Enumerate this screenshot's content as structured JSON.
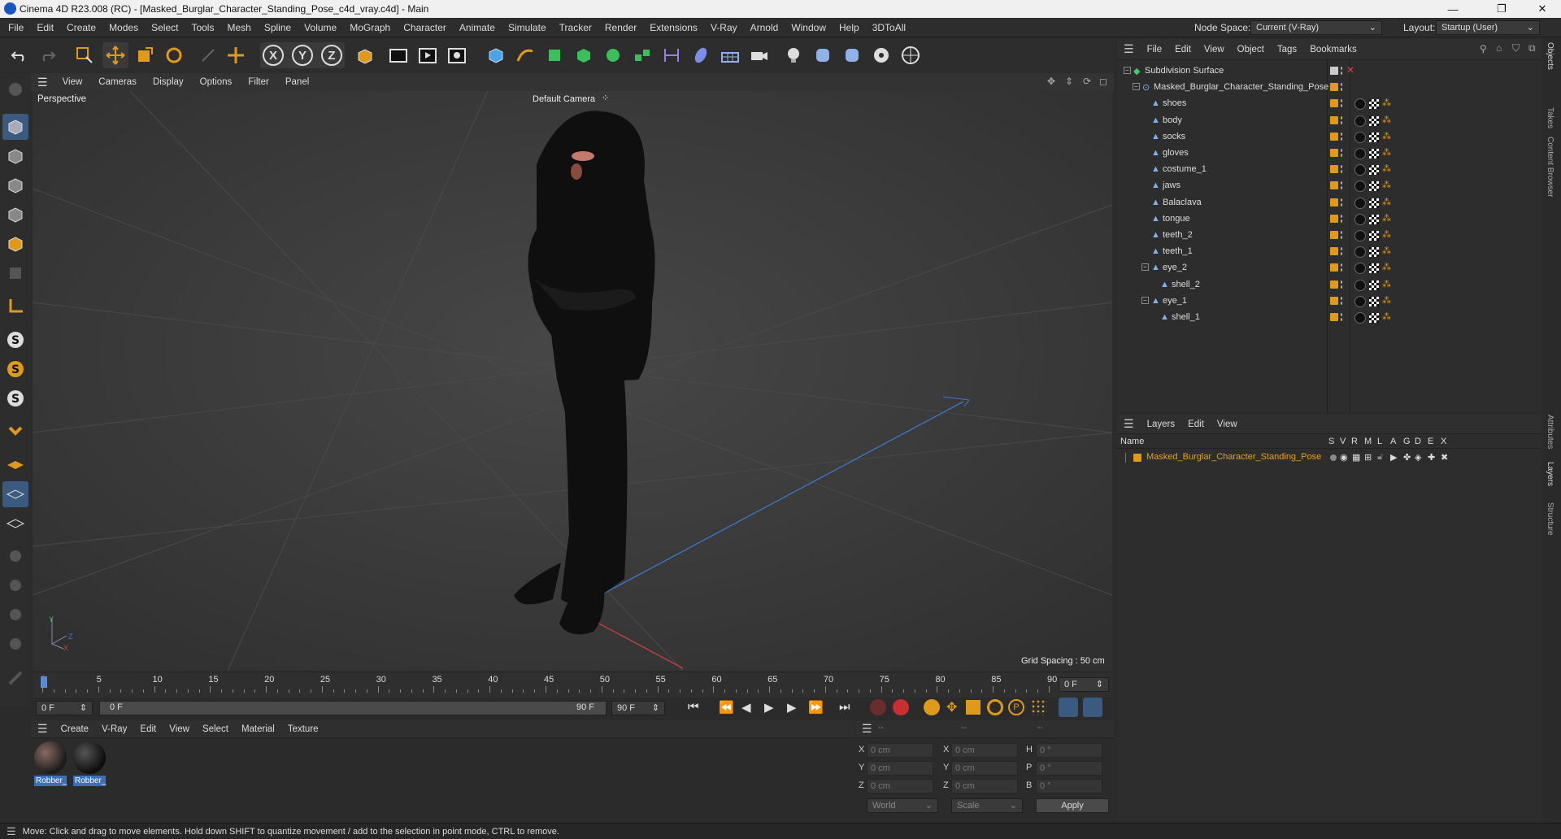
{
  "window": {
    "title": "Cinema 4D R23.008 (RC) - [Masked_Burglar_Character_Standing_Pose_c4d_vray.c4d] - Main",
    "controls": [
      "—",
      "❐",
      "✕"
    ]
  },
  "menubar": {
    "items": [
      "File",
      "Edit",
      "Create",
      "Modes",
      "Select",
      "Tools",
      "Mesh",
      "Spline",
      "Volume",
      "MoGraph",
      "Character",
      "Animate",
      "Simulate",
      "Tracker",
      "Render",
      "Extensions",
      "V-Ray",
      "Arnold",
      "Window",
      "Help",
      "3DToAll"
    ],
    "node_space_label": "Node Space:",
    "node_space_value": "Current (V-Ray)",
    "layout_label": "Layout:",
    "layout_value": "Startup (User)"
  },
  "viewport": {
    "menu": [
      "View",
      "Cameras",
      "Display",
      "Options",
      "Filter",
      "Panel"
    ],
    "view_name": "Perspective",
    "camera_label": "Default Camera",
    "grid_spacing": "Grid Spacing : 50 cm",
    "axis_y": "Y",
    "axis_z": "Z",
    "axis_x": "X"
  },
  "timeline": {
    "ticks": [
      "0",
      "5",
      "10",
      "15",
      "20",
      "25",
      "30",
      "35",
      "40",
      "45",
      "50",
      "55",
      "60",
      "65",
      "70",
      "75",
      "80",
      "85",
      "90"
    ],
    "current_frame_field": "0 F"
  },
  "transport": {
    "start_field": "0 F",
    "range_start": "0 F",
    "range_end": "90 F",
    "end_field": "90 F"
  },
  "material_panel": {
    "menu": [
      "Create",
      "V-Ray",
      "Edit",
      "View",
      "Select",
      "Material",
      "Texture"
    ],
    "materials": [
      {
        "label": "Robber_"
      },
      {
        "label": "Robber_"
      }
    ]
  },
  "coord_panel": {
    "col_headers": [
      "--",
      "--",
      "--"
    ],
    "rows": [
      {
        "a": "X",
        "av": "0 cm",
        "b": "X",
        "bv": "0 cm",
        "c": "H",
        "cv": "0 °"
      },
      {
        "a": "Y",
        "av": "0 cm",
        "b": "Y",
        "bv": "0 cm",
        "c": "P",
        "cv": "0 °"
      },
      {
        "a": "Z",
        "av": "0 cm",
        "b": "Z",
        "bv": "0 cm",
        "c": "B",
        "cv": "0 °"
      }
    ],
    "world": "World",
    "scale": "Scale",
    "apply": "Apply"
  },
  "object_manager": {
    "menu": [
      "File",
      "Edit",
      "View",
      "Object",
      "Tags",
      "Bookmarks"
    ],
    "objects": [
      {
        "name": "Subdivision Surface",
        "level": 0
      },
      {
        "name": "Masked_Burglar_Character_Standing_Pose",
        "level": 1
      },
      {
        "name": "shoes",
        "level": 2
      },
      {
        "name": "body",
        "level": 2
      },
      {
        "name": "socks",
        "level": 2
      },
      {
        "name": "gloves",
        "level": 2
      },
      {
        "name": "costume_1",
        "level": 2
      },
      {
        "name": "jaws",
        "level": 2
      },
      {
        "name": "Balaclava",
        "level": 2
      },
      {
        "name": "tongue",
        "level": 2
      },
      {
        "name": "teeth_2",
        "level": 2
      },
      {
        "name": "teeth_1",
        "level": 2
      },
      {
        "name": "eye_2",
        "level": 2
      },
      {
        "name": "shell_2",
        "level": 3
      },
      {
        "name": "eye_1",
        "level": 2
      },
      {
        "name": "shell_1",
        "level": 3
      }
    ]
  },
  "layer_manager": {
    "menu": [
      "Layers",
      "Edit",
      "View"
    ],
    "col_name": "Name",
    "col_flags": [
      "S",
      "V",
      "R",
      "M",
      "L",
      "A",
      "G",
      "D",
      "E",
      "X"
    ],
    "layers": [
      {
        "name": "Masked_Burglar_Character_Standing_Pose"
      }
    ]
  },
  "right_tabs": [
    "Objects",
    "Takes",
    "Content Browser",
    "Attributes",
    "Layers",
    "Structure"
  ],
  "status": {
    "text": "Move: Click and drag to move elements. Hold down SHIFT to quantize movement / add to the selection in point mode, CTRL to remove."
  },
  "colors": {
    "accent_orange": "#e09a1b",
    "layer_text": "#e8a020",
    "selection_blue": "#3b6fb6"
  }
}
